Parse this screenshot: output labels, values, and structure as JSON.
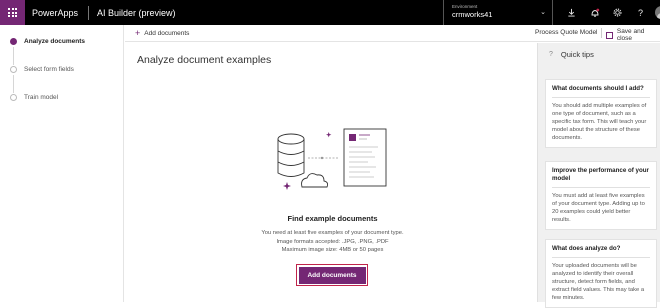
{
  "topbar": {
    "app_name": "PowerApps",
    "product_name": "AI Builder (preview)",
    "environment_label": "Environment",
    "environment_value": "crmworks41",
    "icons": [
      "waffle-icon",
      "download-icon",
      "notification-icon",
      "settings-icon",
      "help-icon",
      "user-avatar"
    ]
  },
  "steps": [
    {
      "label": "Analyze documents",
      "state": "active"
    },
    {
      "label": "Select form fields",
      "state": "pending"
    },
    {
      "label": "Train model",
      "state": "pending"
    }
  ],
  "commandbar": {
    "add_documents": "Add documents",
    "model_name": "Process Quote Model",
    "save_and_close": "Save and close"
  },
  "main": {
    "title": "Analyze document examples",
    "find_title": "Find example documents",
    "desc_line1": "You need at least five examples of your document type.",
    "desc_line2": "Image formats accepted: .JPG, .PNG, .PDF",
    "desc_line3": "Maximum image size: 4MB or 50 pages",
    "add_button": "Add documents"
  },
  "tips": {
    "header": "Quick tips",
    "cards": [
      {
        "title": "What documents should I add?",
        "body": "You should add multiple examples of one type of document, such as a specific tax form. This will teach your model about the structure of these documents."
      },
      {
        "title": "Improve the performance of your model",
        "body": "You must add at least five examples of your document type. Adding up to 20 examples could yield better results."
      },
      {
        "title": "What does analyze do?",
        "body": "Your uploaded documents will be analyzed to identify their overall structure, detect form fields, and extract field values. This may take a few minutes."
      }
    ]
  },
  "colors": {
    "brand": "#742774",
    "focus_border": "#c0244a",
    "topbar": "#000000",
    "panel": "#f0f0f0"
  }
}
